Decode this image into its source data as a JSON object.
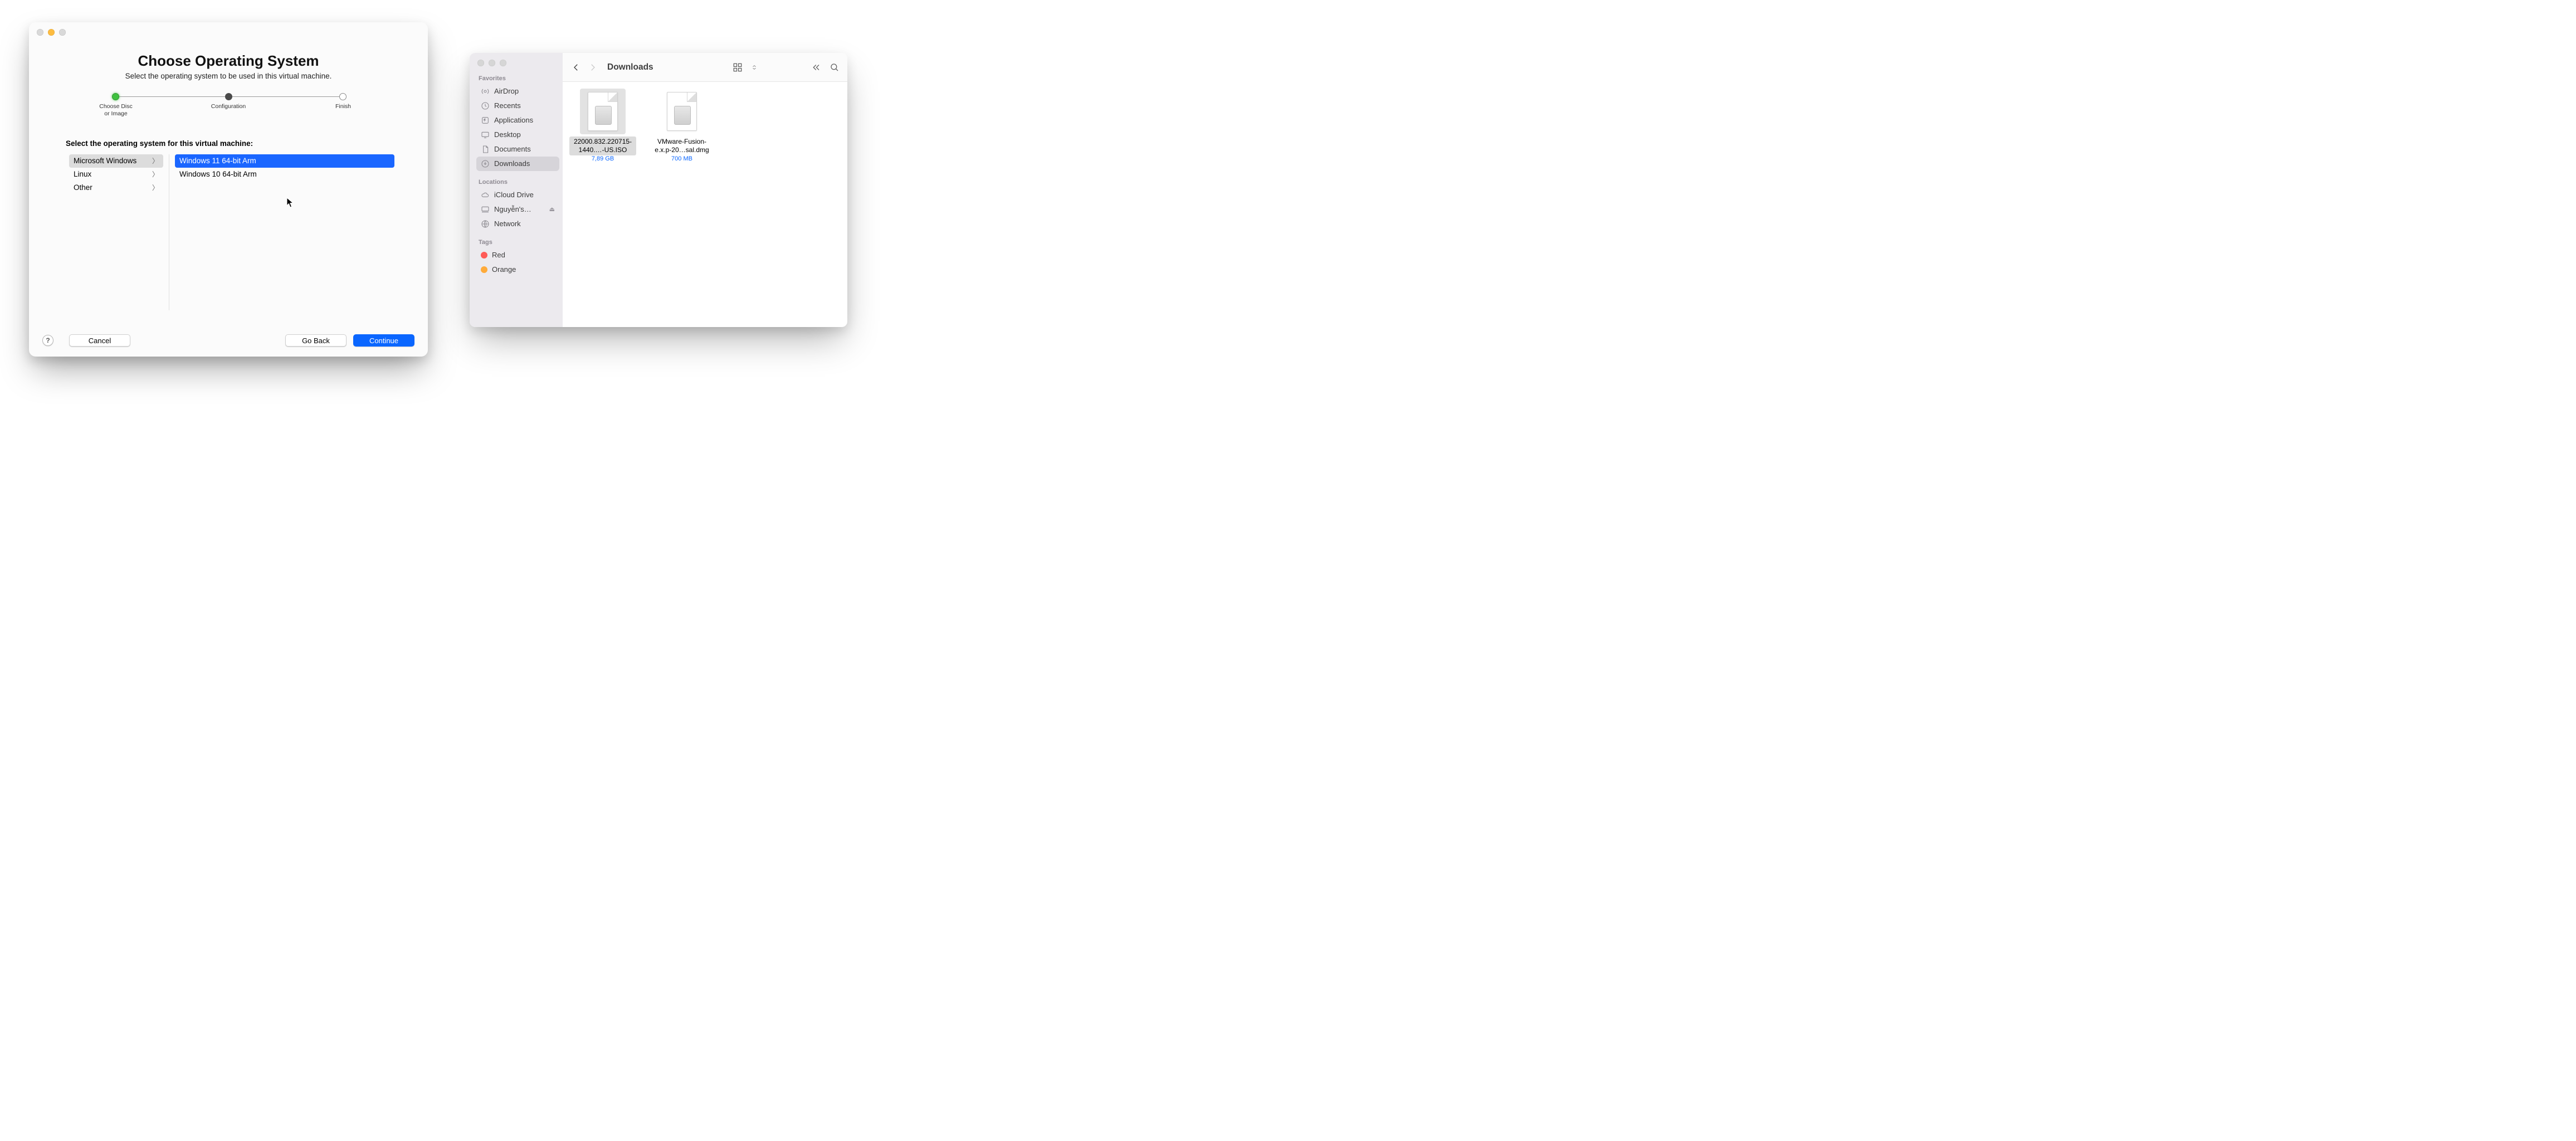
{
  "wizard": {
    "title": "Choose Operating System",
    "subtitle": "Select the operating system to be used in this virtual machine.",
    "steps": {
      "choose": "Choose Disc\nor Image",
      "config": "Configuration",
      "finish": "Finish"
    },
    "prompt": "Select the operating system for this virtual machine:",
    "categories": {
      "windows": "Microsoft Windows",
      "linux": "Linux",
      "other": "Other"
    },
    "versions": {
      "win11": "Windows 11 64-bit Arm",
      "win10": "Windows 10 64-bit Arm"
    },
    "buttons": {
      "help": "?",
      "cancel": "Cancel",
      "goback": "Go Back",
      "continue": "Continue"
    }
  },
  "finder": {
    "title": "Downloads",
    "sections": {
      "favorites": "Favorites",
      "locations": "Locations",
      "tags": "Tags"
    },
    "sidebar": {
      "airdrop": "AirDrop",
      "recents": "Recents",
      "applications": "Applications",
      "desktop": "Desktop",
      "documents": "Documents",
      "downloads": "Downloads",
      "icloud": "iCloud Drive",
      "userdrive": "Nguyễn's…",
      "network": "Network"
    },
    "tag_labels": {
      "red": "Red",
      "orange": "Orange"
    },
    "tag_colors": {
      "red": "#ff5b57",
      "orange": "#ffab3a"
    },
    "files": {
      "iso": {
        "name": "22000.832.220715-1440.…-US.ISO",
        "size": "7,89 GB"
      },
      "dmg": {
        "name": "VMware-Fusion-e.x.p-20…sal.dmg",
        "size": "700 MB"
      }
    }
  }
}
